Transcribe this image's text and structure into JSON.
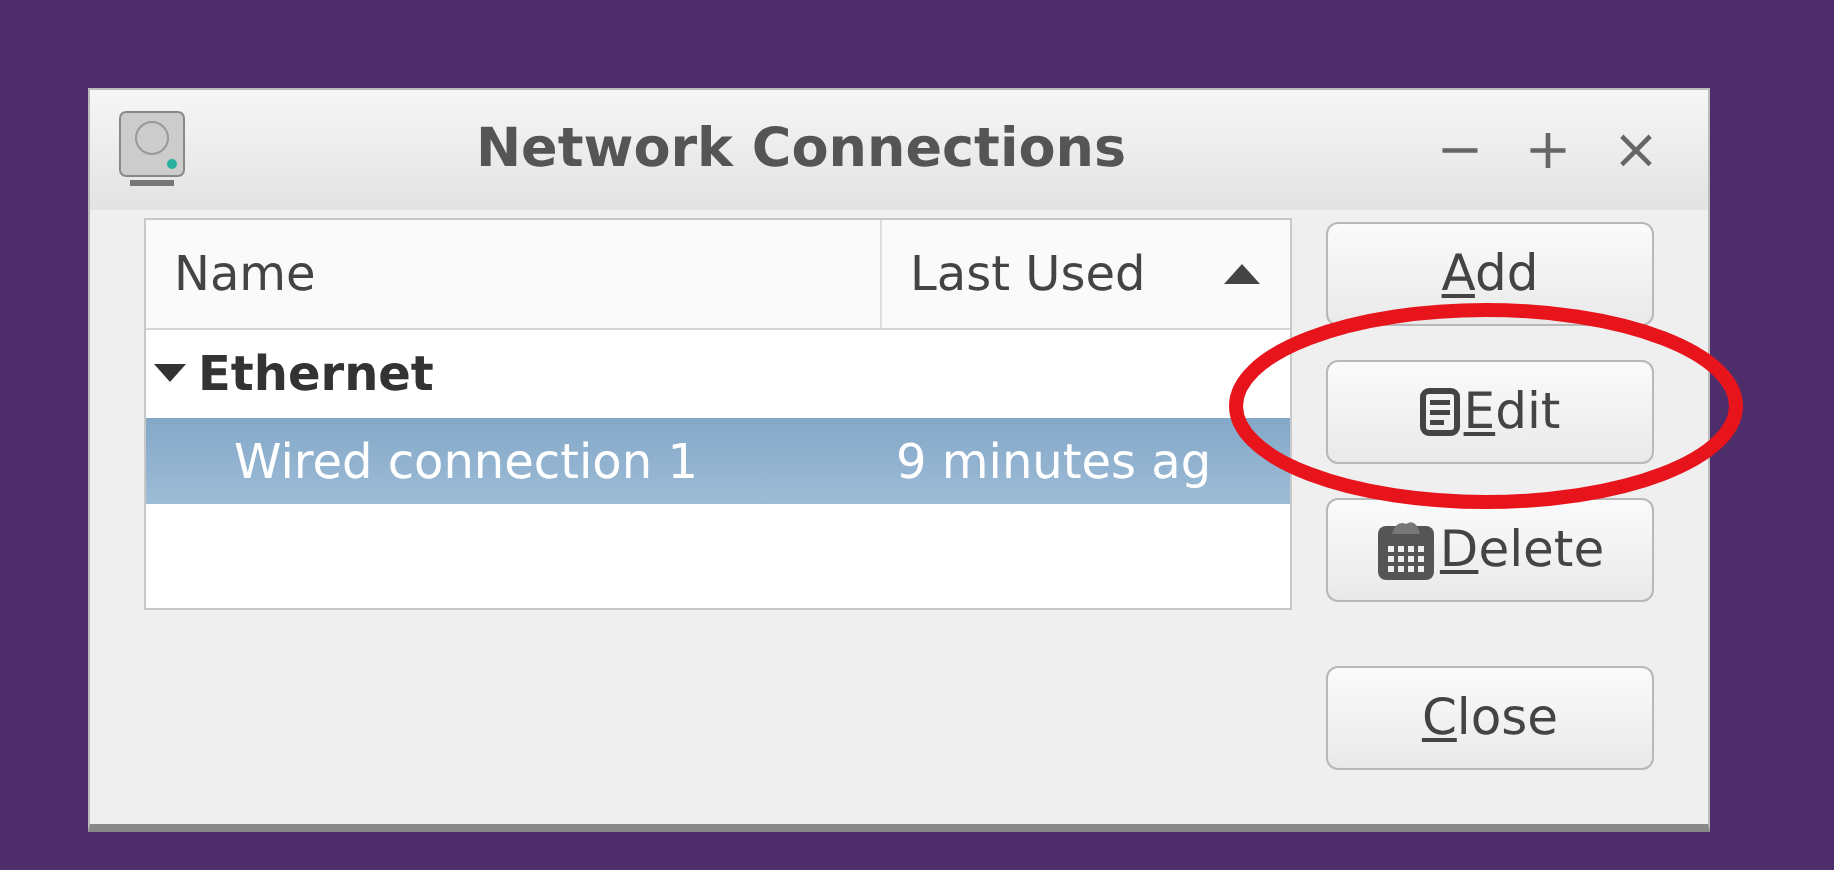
{
  "window": {
    "title": "Network Connections",
    "controls": [
      "−",
      "+",
      "×"
    ]
  },
  "table": {
    "columns": [
      {
        "label": "Name",
        "sorted": false
      },
      {
        "label": "Last Used",
        "sorted": true
      }
    ],
    "groups": [
      {
        "label": "Ethernet",
        "expanded": true,
        "children": [
          {
            "name": "Wired connection 1",
            "last_used": "9 minutes ag",
            "selected": true
          }
        ]
      }
    ]
  },
  "buttons": [
    {
      "label": "Add",
      "kind": "plain",
      "mnemonic_first": true
    },
    {
      "label": "Edit",
      "kind": "edit",
      "mnemonic_first": true
    },
    {
      "label": "Delete",
      "kind": "delete",
      "mnemonic_first": true
    },
    {
      "label": "Close",
      "kind": "plain",
      "mnemonic_first": true
    }
  ],
  "annotation": {
    "kind": "ellipse"
  }
}
